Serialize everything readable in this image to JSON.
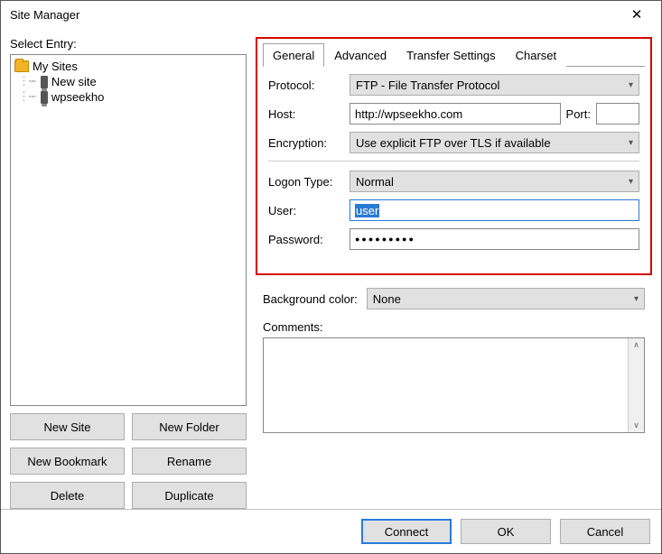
{
  "window": {
    "title": "Site Manager"
  },
  "left": {
    "label": "Select Entry:",
    "root": "My Sites",
    "sites": [
      "New site",
      "wpseekho"
    ],
    "buttons": {
      "new_site": "New Site",
      "new_folder": "New Folder",
      "new_bookmark": "New Bookmark",
      "rename": "Rename",
      "delete": "Delete",
      "duplicate": "Duplicate"
    }
  },
  "tabs": {
    "general": "General",
    "advanced": "Advanced",
    "transfer": "Transfer Settings",
    "charset": "Charset"
  },
  "form": {
    "protocol_label": "Protocol:",
    "protocol_value": "FTP - File Transfer Protocol",
    "host_label": "Host:",
    "host_value": "http://wpseekho.com",
    "port_label": "Port:",
    "port_value": "",
    "encryption_label": "Encryption:",
    "encryption_value": "Use explicit FTP over TLS if available",
    "logon_label": "Logon Type:",
    "logon_value": "Normal",
    "user_label": "User:",
    "user_value": "user",
    "password_label": "Password:",
    "password_mask": "●●●●●●●●●"
  },
  "below": {
    "bg_label": "Background color:",
    "bg_value": "None",
    "comments_label": "Comments:"
  },
  "footer": {
    "connect": "Connect",
    "ok": "OK",
    "cancel": "Cancel"
  }
}
